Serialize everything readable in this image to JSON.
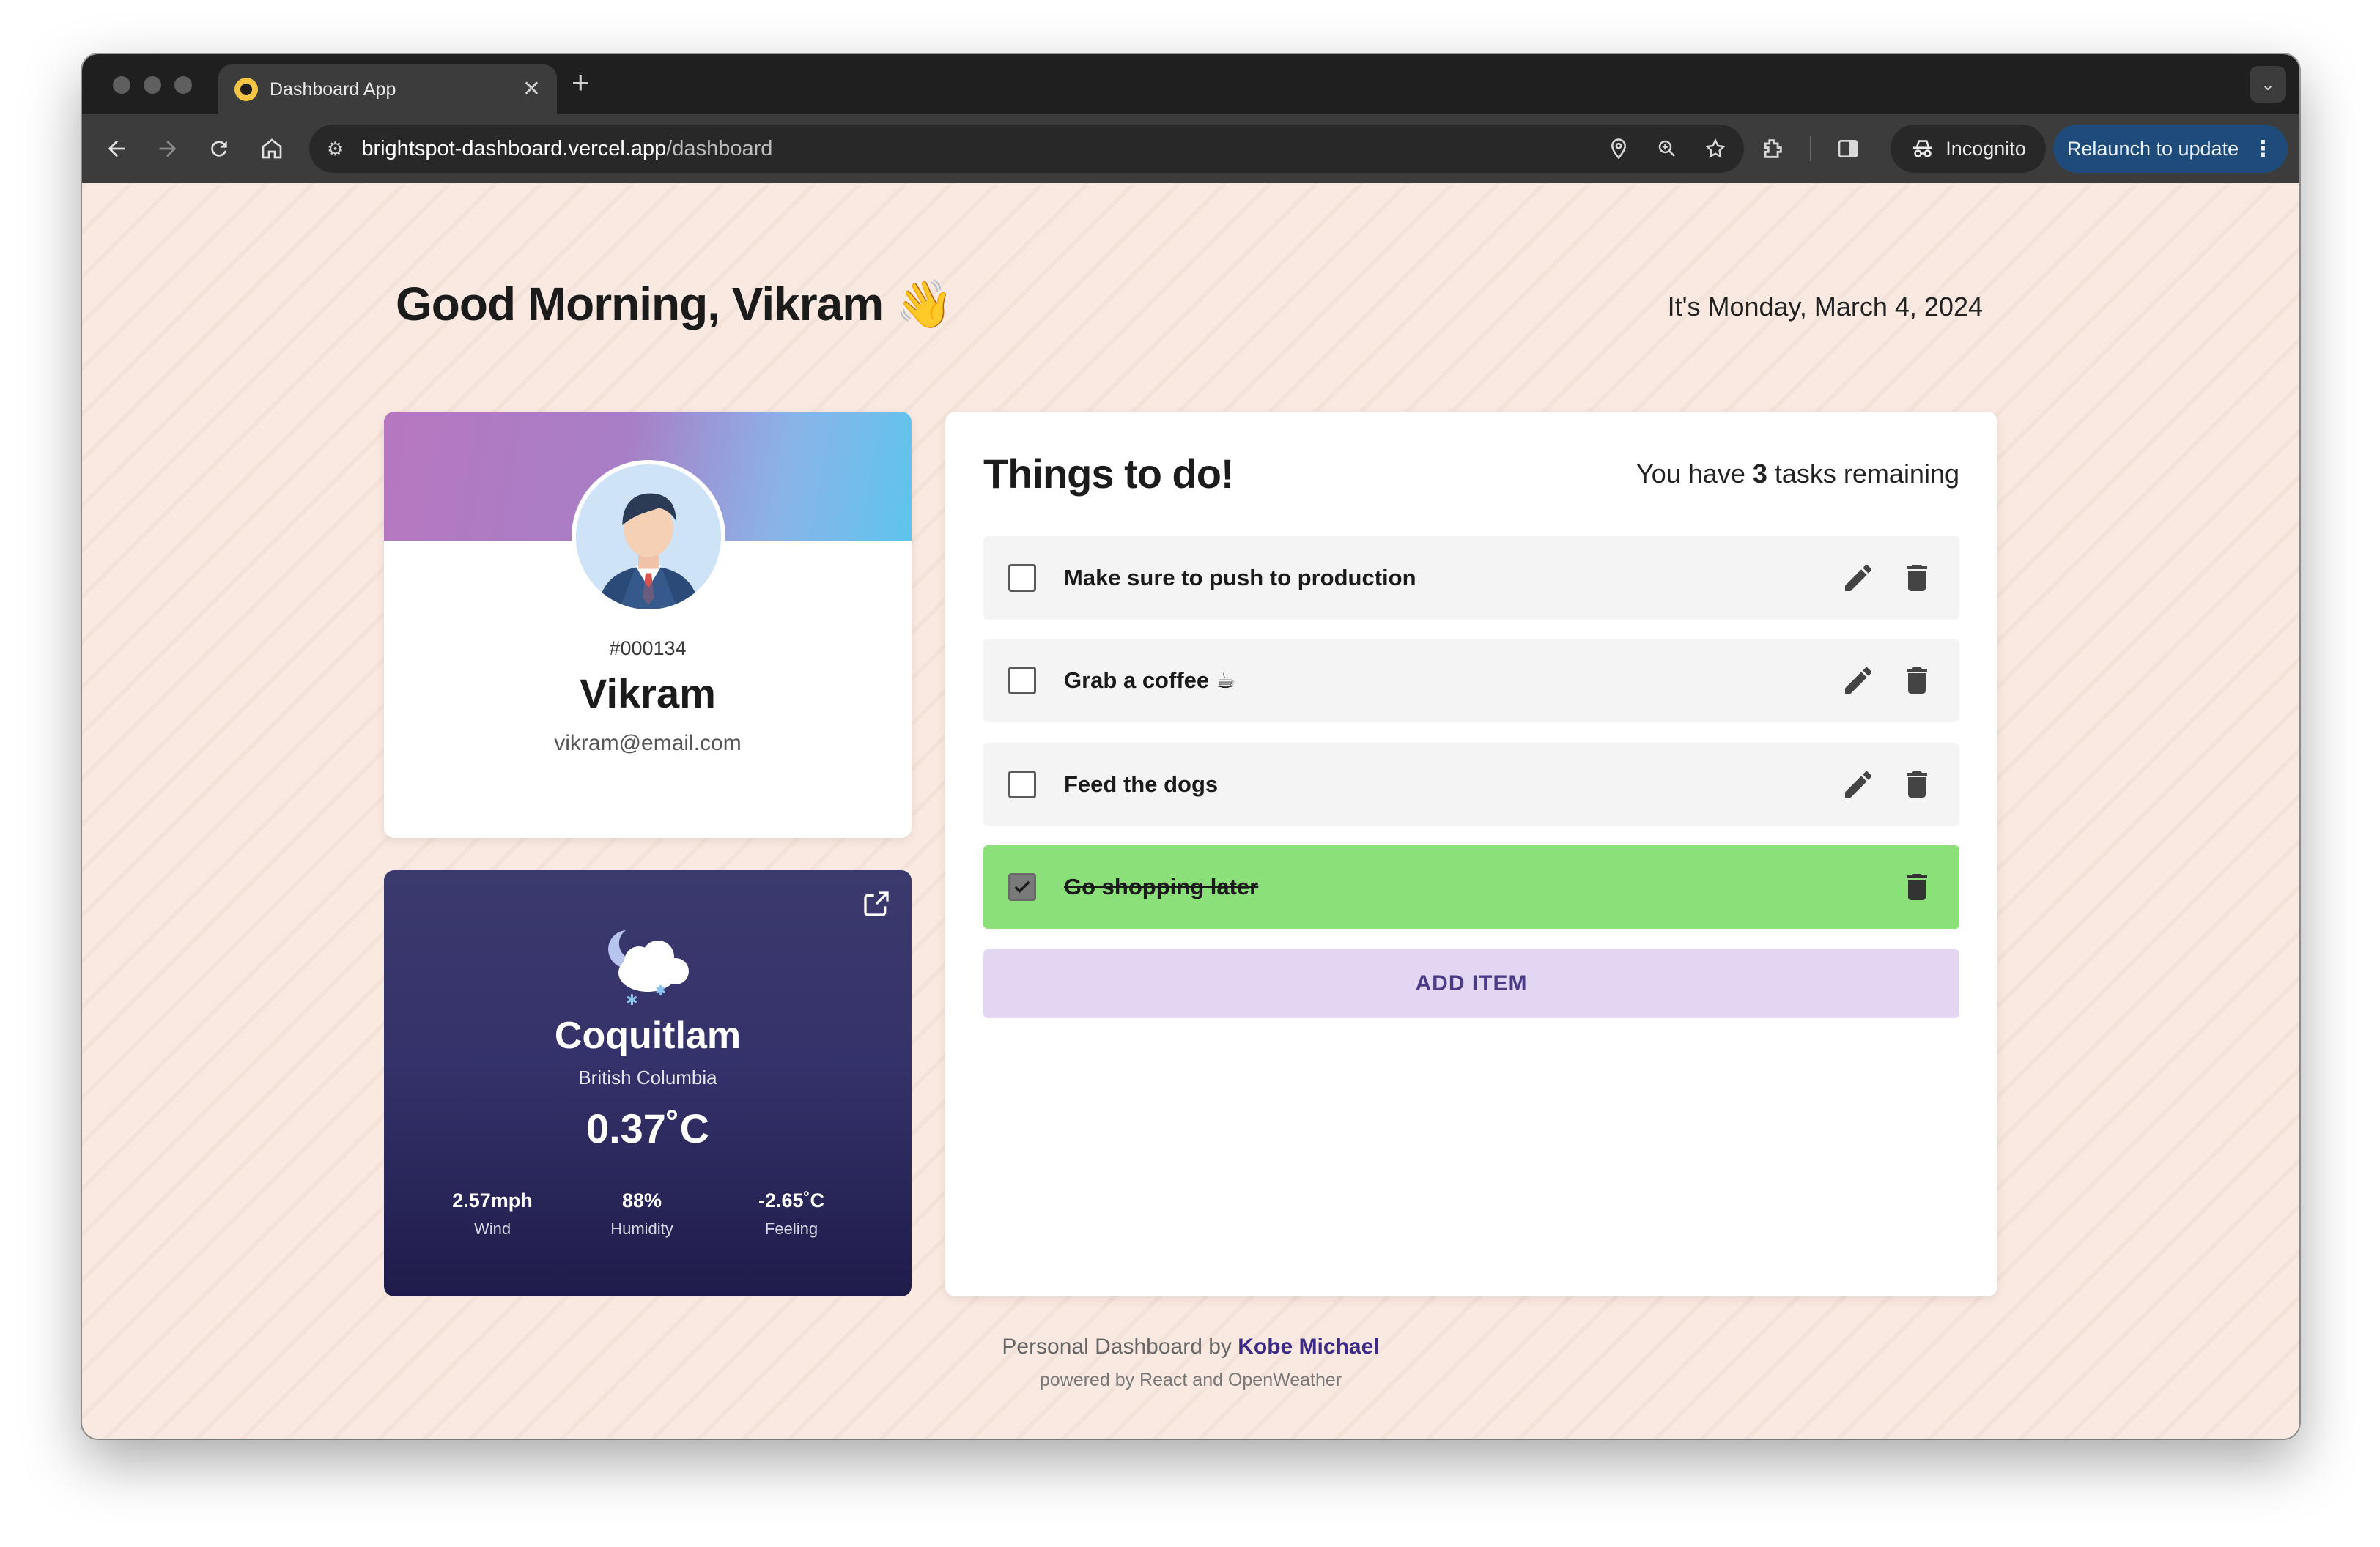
{
  "browser": {
    "tab_title": "Dashboard App",
    "url_host": "brightspot-dashboard.vercel.app",
    "url_path": "/dashboard",
    "incognito_label": "Incognito",
    "relaunch_label": "Relaunch to update"
  },
  "header": {
    "greeting": "Good Morning, Vikram",
    "greeting_emoji": "👋",
    "date": "It's Monday, March 4, 2024"
  },
  "profile": {
    "id": "#000134",
    "name": "Vikram",
    "email": "vikram@email.com"
  },
  "weather": {
    "city": "Coquitlam",
    "region": "British Columbia",
    "temperature": "0.37˚C",
    "stats": [
      {
        "value": "2.57mph",
        "label": "Wind"
      },
      {
        "value": "88%",
        "label": "Humidity"
      },
      {
        "value": "-2.65˚C",
        "label": "Feeling"
      }
    ]
  },
  "todo": {
    "title": "Things to do!",
    "remaining_prefix": "You have ",
    "remaining_count": "3",
    "remaining_suffix": " tasks remaining",
    "tasks": [
      {
        "text": "Make sure to push to production",
        "done": false
      },
      {
        "text": "Grab a coffee ☕",
        "done": false
      },
      {
        "text": "Feed the dogs",
        "done": false
      },
      {
        "text": "Go shopping later",
        "done": true
      }
    ],
    "add_label": "ADD ITEM"
  },
  "footer": {
    "line1_prefix": "Personal Dashboard by ",
    "author": "Kobe Michael",
    "line2": "powered by React and OpenWeather"
  },
  "colors": {
    "page_bg": "#f9e9e1",
    "done_task": "#8ce07a",
    "add_item_bg": "#e2d6f3",
    "accent": "#3b2a86"
  }
}
